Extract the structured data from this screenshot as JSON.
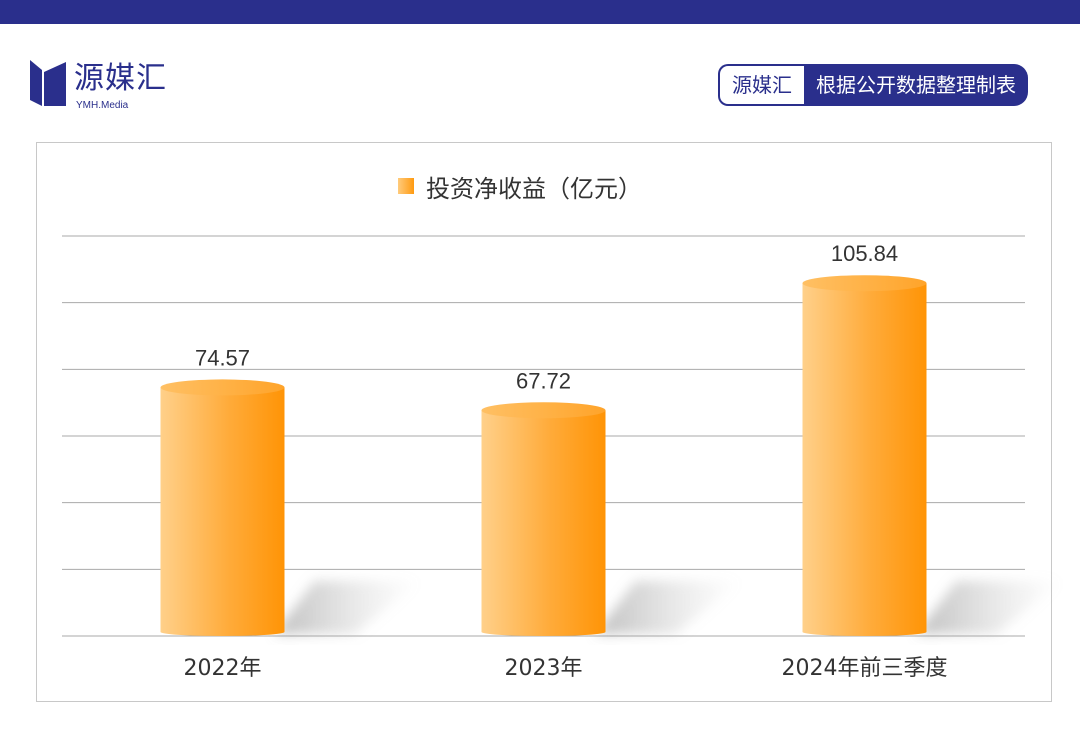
{
  "header": {
    "logo_name": "源媒汇",
    "logo_sub": "YMH.Media",
    "source_brand": "源媒汇",
    "source_desc": "根据公开数据整理制表"
  },
  "colors": {
    "brand": "#2a2f8c",
    "bar_light": "#ffcb7c",
    "bar_dark": "#ff9a10"
  },
  "chart_data": {
    "type": "bar",
    "style": "3d-cylinder",
    "categories": [
      "2022年",
      "2023年",
      "2024年前三季度"
    ],
    "series": [
      {
        "name": "投资净收益（亿元）",
        "values": [
          74.57,
          67.72,
          105.84
        ]
      }
    ],
    "data_labels": [
      "74.57",
      "67.72",
      "105.84"
    ],
    "ylim": [
      0,
      120
    ],
    "grid": true,
    "legend_position": "top-center"
  }
}
